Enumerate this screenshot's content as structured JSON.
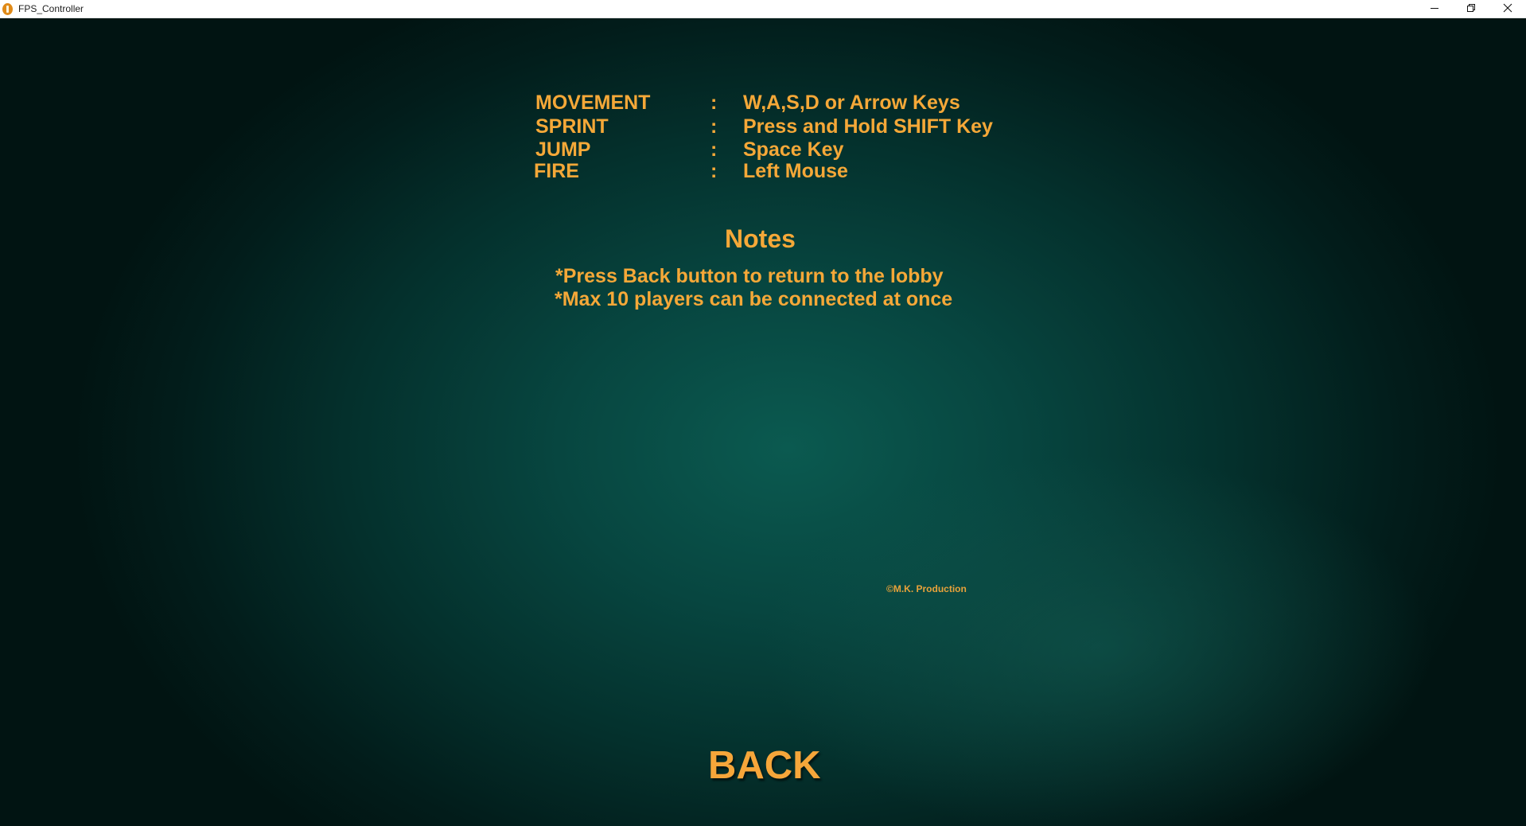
{
  "window": {
    "title": "FPS_Controller",
    "icons": {
      "app": "app-icon",
      "minimize": "minimize-icon",
      "restore": "restore-icon",
      "close": "close-icon"
    }
  },
  "controls": [
    {
      "action": "MOVEMENT",
      "separator": ":",
      "binding": "W,A,S,D or Arrow Keys"
    },
    {
      "action": "SPRINT",
      "separator": ":",
      "binding": "Press and Hold SHIFT Key"
    },
    {
      "action": "JUMP",
      "separator": ":",
      "binding": "Space Key"
    },
    {
      "action": "FIRE",
      "separator": ":",
      "binding": "Left Mouse"
    }
  ],
  "notes": {
    "title": "Notes",
    "items": [
      "*Press Back button to return to the lobby",
      "*Max 10 players can be connected at once"
    ]
  },
  "copyright": "©M.K. Production",
  "back_label": "BACK",
  "colors": {
    "text_accent": "#f5a838",
    "background": "#074640"
  }
}
